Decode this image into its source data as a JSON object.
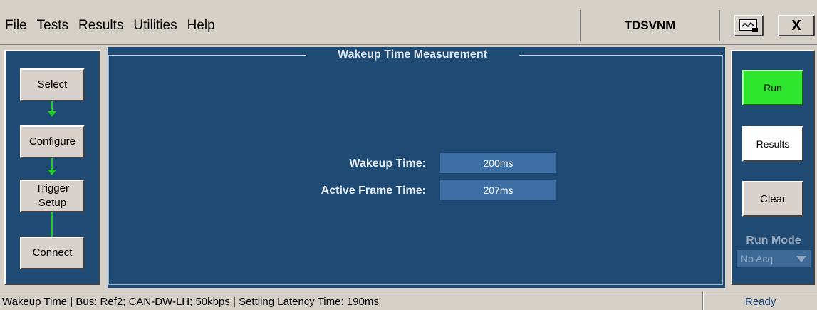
{
  "menu": {
    "file": "File",
    "tests": "Tests",
    "results": "Results",
    "utilities": "Utilities",
    "help": "Help"
  },
  "app_title": "TDSVNM",
  "window_buttons": {
    "close": "X"
  },
  "left_flow": {
    "select": "Select",
    "configure": "Configure",
    "trigger_line1": "Trigger",
    "trigger_line2": "Setup",
    "connect": "Connect"
  },
  "panel": {
    "title": "Wakeup Time Measurement",
    "fields": [
      {
        "label": "Wakeup Time:",
        "value": "200ms"
      },
      {
        "label": "Active Frame Time:",
        "value": "207ms"
      }
    ]
  },
  "right_controls": {
    "run": "Run",
    "results": "Results",
    "clear": "Clear",
    "run_mode_label": "Run Mode",
    "run_mode_value": "No Acq"
  },
  "status": {
    "text": "Wakeup Time  |  Bus: Ref2; CAN-DW-LH; 50kbps  |  Settling Latency Time: 190ms",
    "state": "Ready"
  },
  "colors": {
    "panel_bg": "#1f4a74",
    "run_button": "#2ee62e",
    "flow_arrow": "#22cc22"
  }
}
